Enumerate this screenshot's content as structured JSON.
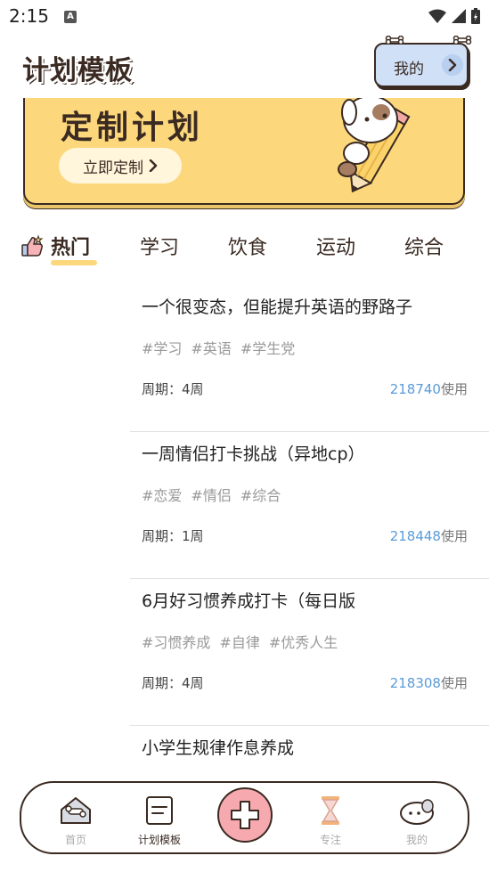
{
  "status": {
    "time": "2:15",
    "notif_letter": "A"
  },
  "header": {
    "title": "计划模板",
    "my_button_label": "我的"
  },
  "banner": {
    "title": "定制计划",
    "button_label": "立即定制"
  },
  "tabs": [
    {
      "label": "热门"
    },
    {
      "label": "学习"
    },
    {
      "label": "饮食"
    },
    {
      "label": "运动"
    },
    {
      "label": "综合"
    }
  ],
  "plans": [
    {
      "title": "一个很变态，但能提升英语的野路子",
      "tags": [
        "#学习",
        "#英语",
        "#学生党"
      ],
      "period": "周期：4周",
      "uses": "218740",
      "uses_suffix": "使用"
    },
    {
      "title": "一周情侣打卡挑战（异地cp）",
      "tags": [
        "#恋爱",
        "#情侣",
        "#综合"
      ],
      "period": "周期：1周",
      "uses": "218448",
      "uses_suffix": "使用"
    },
    {
      "title": "6月好习惯养成打卡（每日版",
      "tags": [
        "#习惯养成",
        "#自律",
        "#优秀人生"
      ],
      "period": "周期：4周",
      "uses": "218308",
      "uses_suffix": "使用"
    },
    {
      "title": "小学生规律作息养成",
      "tags": [],
      "period": "",
      "uses": "",
      "uses_suffix": ""
    }
  ],
  "bottom_nav": [
    {
      "label": "首页"
    },
    {
      "label": "计划模板"
    },
    {
      "label": "专注"
    },
    {
      "label": "我的"
    }
  ],
  "colors": {
    "accent_yellow": "#fcd77c",
    "outline": "#3a2a22",
    "link_blue": "#5b9bd8",
    "add_pink": "#f6a9ae"
  }
}
